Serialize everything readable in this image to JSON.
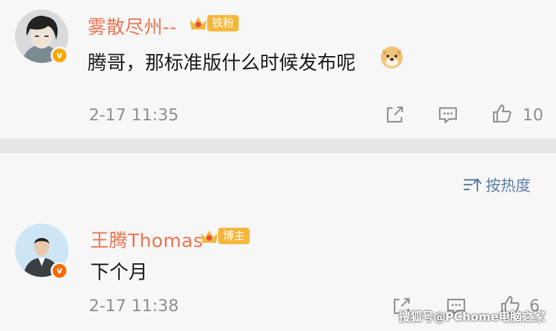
{
  "comments": [
    {
      "username": "雾散尽州--",
      "badge": "铁粉",
      "text": "腾哥，那标准版什么时候发布呢",
      "emoji": "doge-emoji",
      "time": "2-17 11:35",
      "likes": "10"
    },
    {
      "username": "王腾Thomas",
      "badge": "博主",
      "text": "下个月",
      "time": "2-17 11:38",
      "likes": "6"
    }
  ],
  "sort": {
    "label": "按热度"
  },
  "watermark": "搜狐号@PChome电脑之家",
  "colors": {
    "username": "#eb7350",
    "badge_fan": "#f5b73b",
    "badge_host": "#f5b73b",
    "meta": "#8f8f8f",
    "sort_link": "#5b7fa8",
    "verified_yellow": "#f8a700",
    "verified_orange": "#f26b00"
  }
}
